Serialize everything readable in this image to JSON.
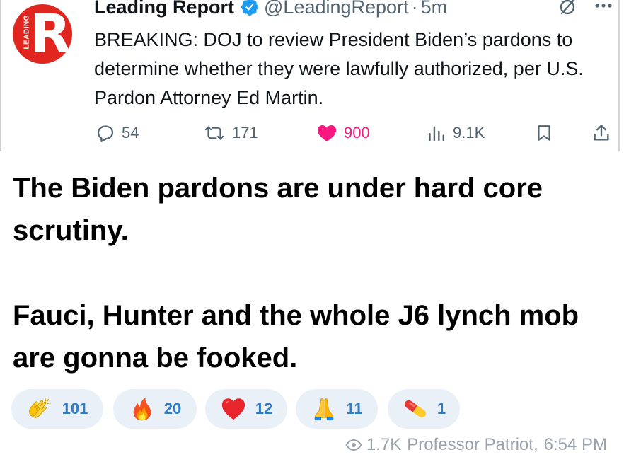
{
  "tweet": {
    "logo_text": "LEADING",
    "logo_letter": "R",
    "author_name": "Leading Report",
    "handle": "@LeadingReport",
    "separator": "·",
    "time": "5m",
    "text": "BREAKING: DOJ to review President Biden’s pardons to determine whether they were lawfully authorized, per U.S. Pardon Attorney Ed Martin.",
    "brand_color": "#e0261f",
    "verified_color": "#1d9bf0",
    "actions": {
      "replies": "54",
      "reposts": "171",
      "likes": "900",
      "views": "9.1K"
    }
  },
  "post": {
    "paragraph_1": "The Biden pardons are under hard core scrutiny.",
    "paragraph_2": "Fauci, Hunter and the whole J6 lynch mob are gonna be fooked."
  },
  "reactions": [
    {
      "emoji": "clapping-hands-icon",
      "count": "101"
    },
    {
      "emoji": "fire-icon",
      "count": "20"
    },
    {
      "emoji": "red-heart-icon",
      "count": "12"
    },
    {
      "emoji": "folded-hands-icon",
      "count": "11"
    },
    {
      "emoji": "pill-icon",
      "count": "1"
    }
  ],
  "footer": {
    "views": "1.7K",
    "author": "Professor Patriot,",
    "time": "6:54 PM"
  }
}
